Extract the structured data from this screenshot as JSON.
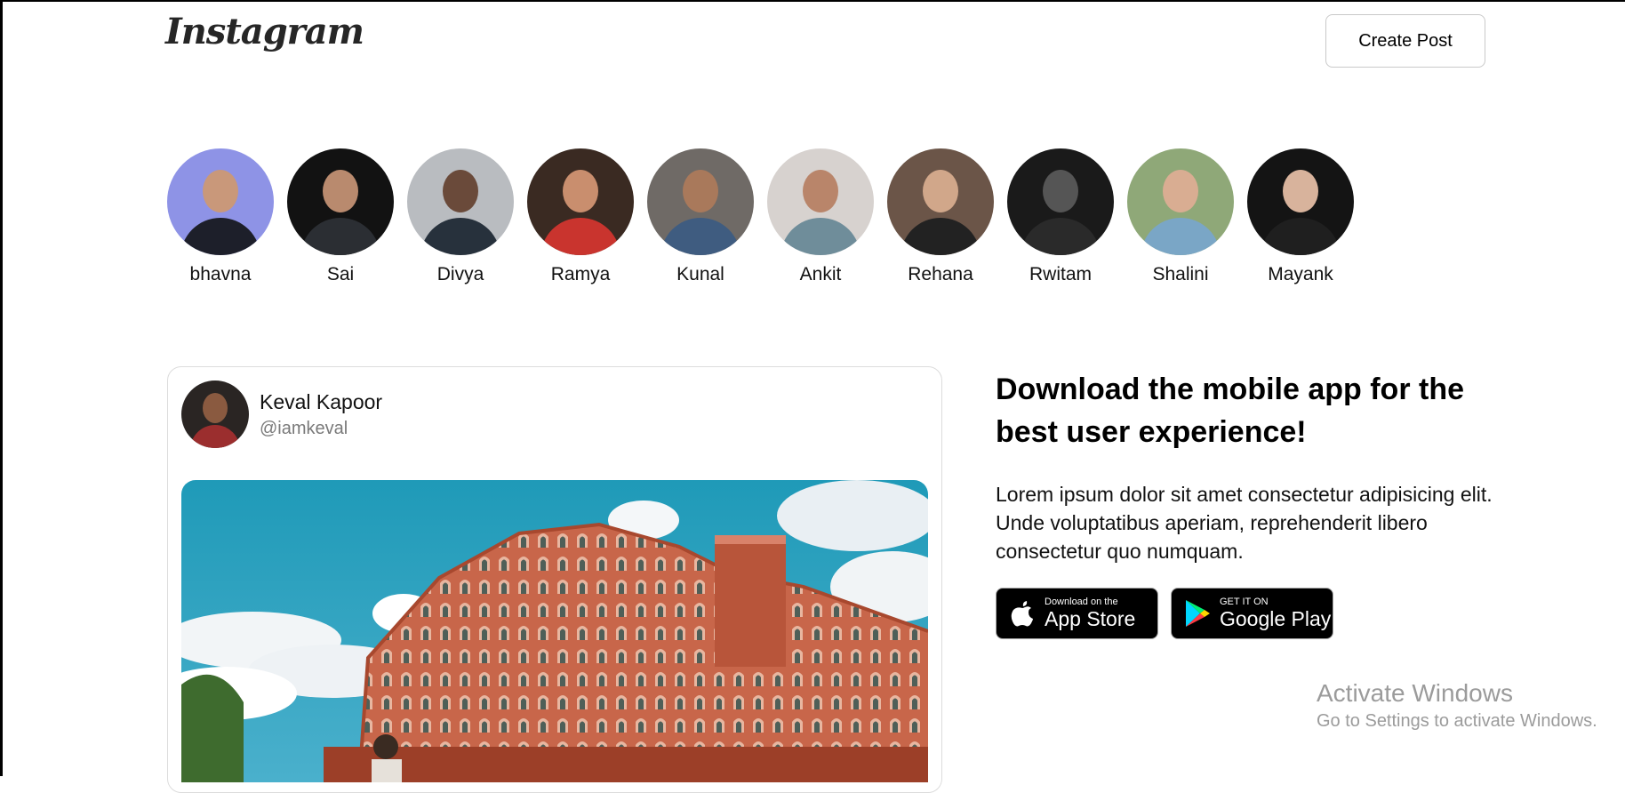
{
  "header": {
    "logo": "Instagram",
    "create_post_label": "Create Post"
  },
  "stories": [
    {
      "name": "bhavna",
      "bg": "#8e93e6",
      "skin": "#c9987a",
      "cloth": "#1d1f2a"
    },
    {
      "name": "Sai",
      "bg": "#121212",
      "skin": "#b98a6e",
      "cloth": "#2b2e33"
    },
    {
      "name": "Divya",
      "bg": "#b9bcc0",
      "skin": "#6a4a3a",
      "cloth": "#27313c"
    },
    {
      "name": "Ramya",
      "bg": "#3a2a22",
      "skin": "#c98e6e",
      "cloth": "#c9342e"
    },
    {
      "name": "Kunal",
      "bg": "#6f6a66",
      "skin": "#a9795b",
      "cloth": "#3f5c80"
    },
    {
      "name": "Ankit",
      "bg": "#d7d2cf",
      "skin": "#b9856a",
      "cloth": "#6f8d9a"
    },
    {
      "name": "Rehana",
      "bg": "#6b5548",
      "skin": "#d1a78a",
      "cloth": "#222222"
    },
    {
      "name": "Rwitam",
      "bg": "#1a1a1a",
      "skin": "#555555",
      "cloth": "#2a2a2a"
    },
    {
      "name": "Shalini",
      "bg": "#8fa878",
      "skin": "#d9ad92",
      "cloth": "#7aa6c6"
    },
    {
      "name": "Mayank",
      "bg": "#141414",
      "skin": "#d8b39c",
      "cloth": "#1f1f1f"
    }
  ],
  "post": {
    "author_name": "Keval Kapoor",
    "author_handle": "@iamkeval"
  },
  "promo": {
    "title": "Download the mobile app for the best user experience!",
    "text": "Lorem ipsum dolor sit amet consectetur adipisicing elit. Unde voluptatibus aperiam, reprehenderit libero consectetur quo numquam.",
    "app_store_small": "Download on the",
    "app_store_big": "App Store",
    "google_play_small": "GET IT ON",
    "google_play_big": "Google Play"
  },
  "watermark": {
    "title": "Activate Windows",
    "subtitle": "Go to Settings to activate Windows."
  }
}
